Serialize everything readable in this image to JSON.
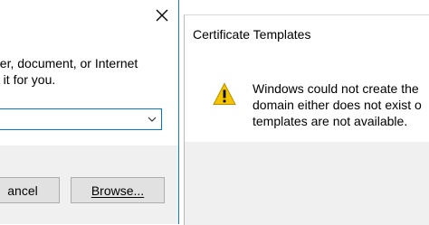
{
  "run_dialog": {
    "description_lines": [
      "der, document, or Internet",
      "a it for you."
    ],
    "open_field": {
      "value": ""
    },
    "buttons": {
      "cancel_label": "ancel",
      "browse_label": "Browse..."
    },
    "close_icon": "close-icon"
  },
  "cert_dialog": {
    "title": "Certificate Templates",
    "message_lines": [
      "Windows could not create the",
      "domain either does not exist o",
      "templates are not available."
    ],
    "icon": "warning-icon"
  },
  "colors": {
    "accent_border": "#1979ca",
    "focus_border": "#0078d7",
    "footer_bg": "#f0f0f0",
    "button_bg": "#e1e1e1",
    "warning_yellow": "#f5c400"
  }
}
